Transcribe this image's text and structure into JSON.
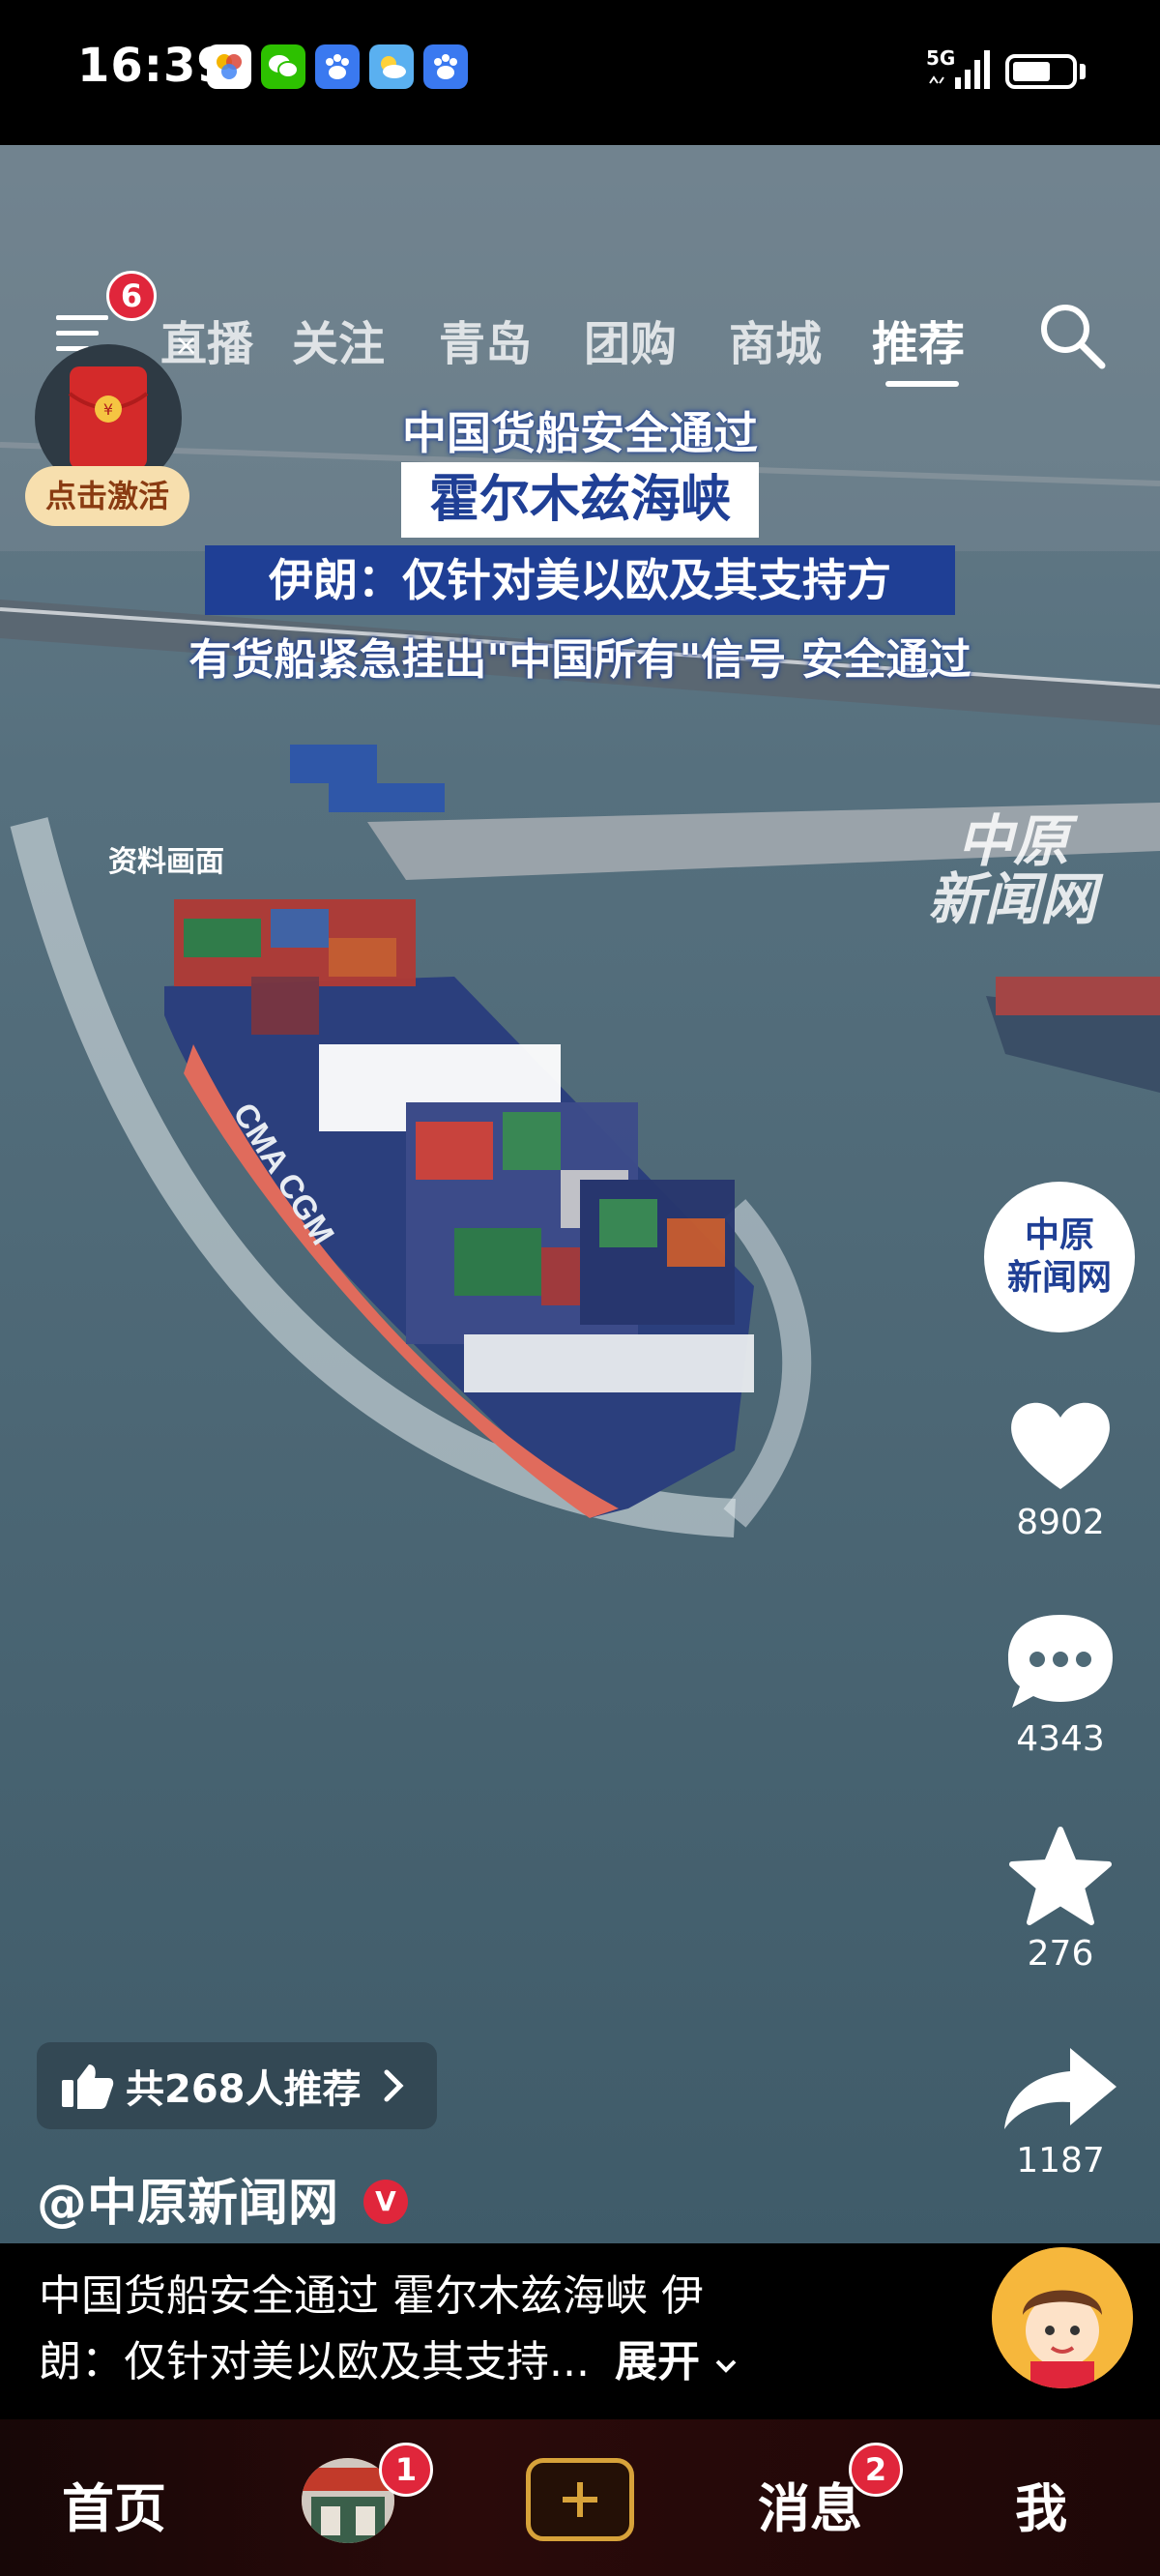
{
  "status_bar": {
    "time": "16:39",
    "network": "5G",
    "apps": [
      {
        "icon": "colorful-app-icon",
        "color": "#ffffff"
      },
      {
        "icon": "wechat-icon",
        "color": "#2dc100"
      },
      {
        "icon": "baidu-icon",
        "color": "#3a79f0"
      },
      {
        "icon": "weather-icon",
        "color": "#5ab0f0"
      },
      {
        "icon": "baidu-icon",
        "color": "#3a79f0"
      }
    ]
  },
  "nav": {
    "menu_badge": "6",
    "tabs": [
      "直播",
      "关注",
      "青岛",
      "团购",
      "商城",
      "推荐"
    ],
    "active_tab": "推荐"
  },
  "promo": {
    "label": "点击激活",
    "close": "×"
  },
  "video": {
    "captions": [
      "中国货船安全通过",
      "霍尔木兹海峡",
      "伊朗：仅针对美以欧及其支持方",
      "有货船紧急挂出\"中国所有\"信号 安全通过"
    ],
    "archive_label": "资料画面",
    "watermark": [
      "中原",
      "新闻网"
    ],
    "ship_hull_text": "CMA CGM"
  },
  "rail": {
    "avatar_text": [
      "中原",
      "新闻网"
    ],
    "likes": "8902",
    "comments": "4343",
    "favorites": "276",
    "shares": "1187"
  },
  "recommend": {
    "label": "共268人推荐"
  },
  "author": {
    "name": "@中原新闻网",
    "verified": "V"
  },
  "description": {
    "line1": "中国货船安全通过 霍尔木兹海峡 伊",
    "line2": "朗：仅针对美以欧及其支持...",
    "expand": "展开"
  },
  "tabbar": {
    "home": "首页",
    "live_badge": "1",
    "messages": "消息",
    "messages_badge": "2",
    "me": "我"
  },
  "colors": {
    "accent_red": "#e0263b",
    "caption_blue": "#1f3f95",
    "caption_text": "#ffffff"
  }
}
